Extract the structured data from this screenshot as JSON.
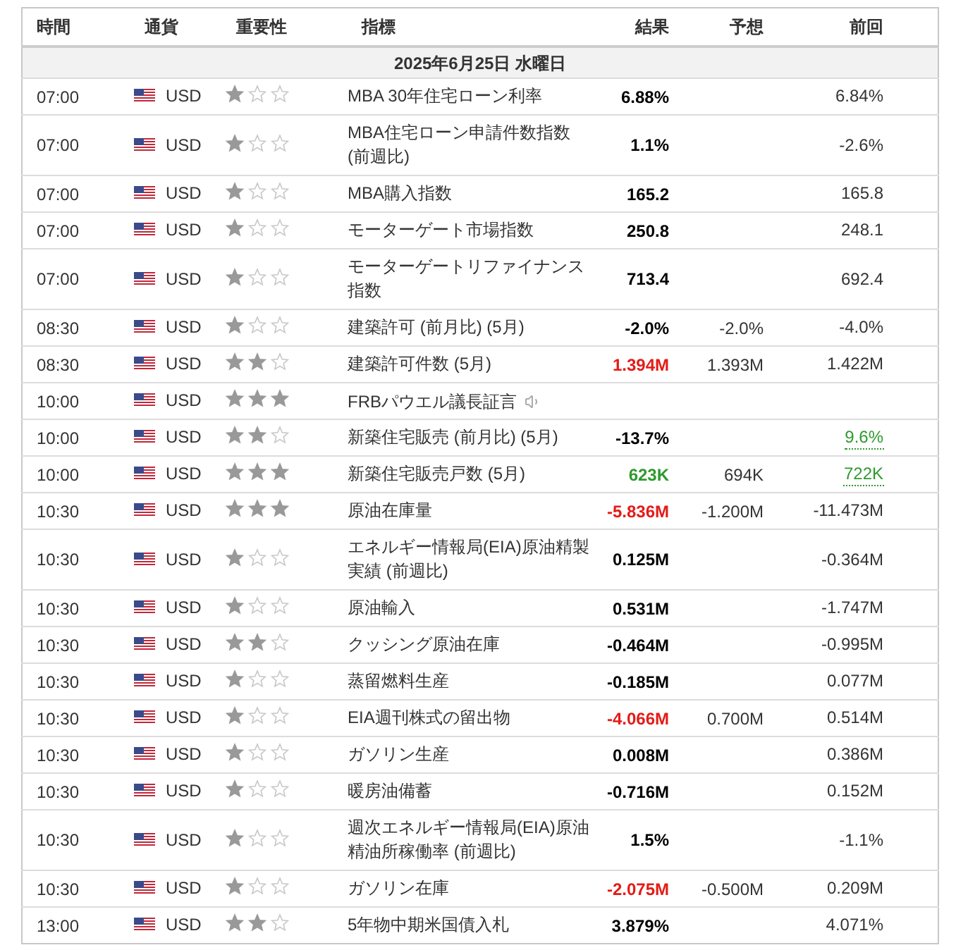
{
  "columns": [
    "時間",
    "通貨",
    "重要性",
    "指標",
    "結果",
    "予想",
    "前回"
  ],
  "date": "2025年6月25日 水曜日",
  "events": [
    {
      "time": "07:00",
      "currency": "USD",
      "stars": 1,
      "name": "MBA 30年住宅ローン利率",
      "actual": {
        "text": "6.88%"
      },
      "previous": {
        "text": "6.84%"
      }
    },
    {
      "time": "07:00",
      "currency": "USD",
      "stars": 1,
      "name": "MBA住宅ローン申請件数指数 (前週比)",
      "actual": {
        "text": "1.1%"
      },
      "previous": {
        "text": "-2.6%"
      }
    },
    {
      "time": "07:00",
      "currency": "USD",
      "stars": 1,
      "name": "MBA購入指数",
      "actual": {
        "text": "165.2"
      },
      "previous": {
        "text": "165.8"
      }
    },
    {
      "time": "07:00",
      "currency": "USD",
      "stars": 1,
      "name": "モーターゲート市場指数",
      "actual": {
        "text": "250.8"
      },
      "previous": {
        "text": "248.1"
      }
    },
    {
      "time": "07:00",
      "currency": "USD",
      "stars": 1,
      "name": "モーターゲートリファイナンス指数",
      "actual": {
        "text": "713.4"
      },
      "previous": {
        "text": "692.4"
      }
    },
    {
      "time": "08:30",
      "currency": "USD",
      "stars": 1,
      "name": "建築許可 (前月比) (5月)",
      "actual": {
        "text": "-2.0%"
      },
      "forecast": "-2.0%",
      "previous": {
        "text": "-4.0%"
      }
    },
    {
      "time": "08:30",
      "currency": "USD",
      "stars": 2,
      "name": "建築許可件数 (5月)",
      "actual": {
        "text": "1.394M",
        "color": "#e41b17"
      },
      "forecast": "1.393M",
      "previous": {
        "text": "1.422M"
      }
    },
    {
      "time": "10:00",
      "currency": "USD",
      "stars": 3,
      "name": "FRBパウエル議長証言",
      "audio": true
    },
    {
      "time": "10:00",
      "currency": "USD",
      "stars": 2,
      "name": "新築住宅販売 (前月比) (5月)",
      "actual": {
        "text": "-13.7%"
      },
      "previous": {
        "text": "9.6%",
        "color": "#2e9a2e",
        "revised": true
      }
    },
    {
      "time": "10:00",
      "currency": "USD",
      "stars": 3,
      "name": "新築住宅販売戸数 (5月)",
      "actual": {
        "text": "623K",
        "color": "#2e9a2e"
      },
      "forecast": "694K",
      "previous": {
        "text": "722K",
        "color": "#2e9a2e",
        "revised": true
      }
    },
    {
      "time": "10:30",
      "currency": "USD",
      "stars": 3,
      "name": "原油在庫量",
      "actual": {
        "text": "-5.836M",
        "color": "#e41b17"
      },
      "forecast": "-1.200M",
      "previous": {
        "text": "-11.473M"
      }
    },
    {
      "time": "10:30",
      "currency": "USD",
      "stars": 1,
      "name": "エネルギー情報局(EIA)原油精製実績 (前週比)",
      "actual": {
        "text": "0.125M"
      },
      "previous": {
        "text": "-0.364M"
      }
    },
    {
      "time": "10:30",
      "currency": "USD",
      "stars": 1,
      "name": "原油輸入",
      "actual": {
        "text": "0.531M"
      },
      "previous": {
        "text": "-1.747M"
      }
    },
    {
      "time": "10:30",
      "currency": "USD",
      "stars": 2,
      "name": "クッシング原油在庫",
      "actual": {
        "text": "-0.464M"
      },
      "previous": {
        "text": "-0.995M"
      }
    },
    {
      "time": "10:30",
      "currency": "USD",
      "stars": 1,
      "name": "蒸留燃料生産",
      "actual": {
        "text": "-0.185M"
      },
      "previous": {
        "text": "0.077M"
      }
    },
    {
      "time": "10:30",
      "currency": "USD",
      "stars": 1,
      "name": "EIA週刊株式の留出物",
      "actual": {
        "text": "-4.066M",
        "color": "#e41b17"
      },
      "forecast": "0.700M",
      "previous": {
        "text": "0.514M"
      }
    },
    {
      "time": "10:30",
      "currency": "USD",
      "stars": 1,
      "name": "ガソリン生産",
      "actual": {
        "text": "0.008M"
      },
      "previous": {
        "text": "0.386M"
      }
    },
    {
      "time": "10:30",
      "currency": "USD",
      "stars": 1,
      "name": "暖房油備蓄",
      "actual": {
        "text": "-0.716M"
      },
      "previous": {
        "text": "0.152M"
      }
    },
    {
      "time": "10:30",
      "currency": "USD",
      "stars": 1,
      "name": "週次エネルギー情報局(EIA)原油精油所稼働率 (前週比)",
      "actual": {
        "text": "1.5%"
      },
      "previous": {
        "text": "-1.1%"
      }
    },
    {
      "time": "10:30",
      "currency": "USD",
      "stars": 1,
      "name": "ガソリン在庫",
      "actual": {
        "text": "-2.075M",
        "color": "#e41b17"
      },
      "forecast": "-0.500M",
      "previous": {
        "text": "0.209M"
      }
    },
    {
      "time": "13:00",
      "currency": "USD",
      "stars": 2,
      "name": "5年物中期米国債入札",
      "actual": {
        "text": "3.879%"
      },
      "previous": {
        "text": "4.071%"
      }
    }
  ]
}
